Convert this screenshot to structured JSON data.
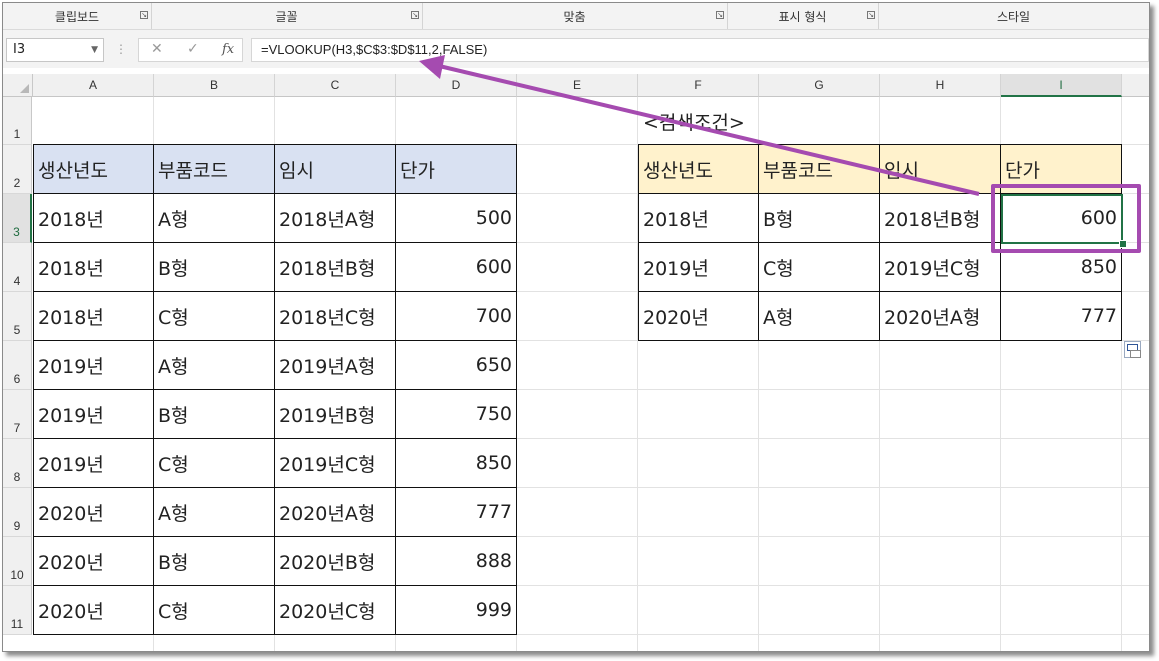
{
  "ribbon": {
    "groups": [
      {
        "label": "클립보드",
        "launcher": "dialog-launcher-icon"
      },
      {
        "label": "글꼴",
        "launcher": "dialog-launcher-icon"
      },
      {
        "label": "맞춤",
        "launcher": "dialog-launcher-icon"
      },
      {
        "label": "표시 형식",
        "launcher": "dialog-launcher-icon"
      },
      {
        "label": "스타일"
      }
    ]
  },
  "formula_bar": {
    "name_box": "I3",
    "cancel_icon": "✕",
    "enter_icon": "✓",
    "fx_label": "fx",
    "formula": "=VLOOKUP(H3,$C$3:$D$11,2,FALSE)"
  },
  "columns": [
    "A",
    "B",
    "C",
    "D",
    "E",
    "F",
    "G",
    "H",
    "I"
  ],
  "rows": [
    "1",
    "2",
    "3",
    "4",
    "5",
    "6",
    "7",
    "8",
    "9",
    "10",
    "11"
  ],
  "selected_cell": "I3",
  "left_table": {
    "headers": [
      "생산년도",
      "부품코드",
      "임시",
      "단가"
    ],
    "rows": [
      [
        "2018년",
        "A형",
        "2018년A형",
        "500"
      ],
      [
        "2018년",
        "B형",
        "2018년B형",
        "600"
      ],
      [
        "2018년",
        "C형",
        "2018년C형",
        "700"
      ],
      [
        "2019년",
        "A형",
        "2019년A형",
        "650"
      ],
      [
        "2019년",
        "B형",
        "2019년B형",
        "750"
      ],
      [
        "2019년",
        "C형",
        "2019년C형",
        "850"
      ],
      [
        "2020년",
        "A형",
        "2020년A형",
        "777"
      ],
      [
        "2020년",
        "B형",
        "2020년B형",
        "888"
      ],
      [
        "2020년",
        "C형",
        "2020년C형",
        "999"
      ]
    ]
  },
  "right_table": {
    "title": "<검색조건>",
    "headers": [
      "생산년도",
      "부품코드",
      "임시",
      "단가"
    ],
    "rows": [
      [
        "2018년",
        "B형",
        "2018년B형",
        "600"
      ],
      [
        "2019년",
        "C형",
        "2019년C형",
        "850"
      ],
      [
        "2020년",
        "A형",
        "2020년A형",
        "777"
      ]
    ]
  },
  "colors": {
    "left_header_fill": "#d9e1f2",
    "right_header_fill": "#fff2cc",
    "selection_green": "#217346",
    "annotation_purple": "#a54bb0"
  }
}
